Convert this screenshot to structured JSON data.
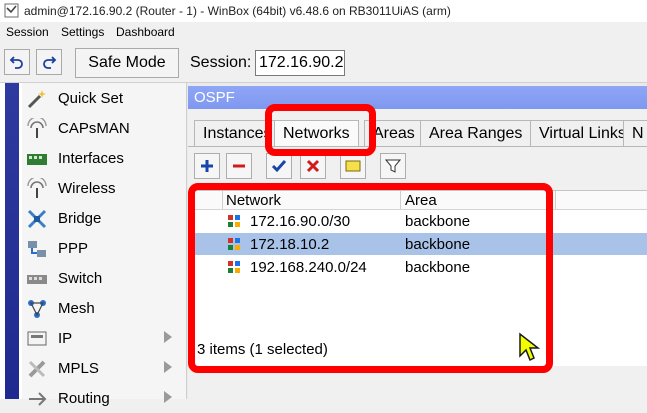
{
  "window": {
    "title": "admin@172.16.90.2 (Router - 1) - WinBox (64bit) v6.48.6 on RB3011UiAS (arm)"
  },
  "menu": [
    "Session",
    "Settings",
    "Dashboard"
  ],
  "toolbar": {
    "safe_mode": "Safe Mode",
    "session_label": "Session:",
    "session_value": "172.16.90.2"
  },
  "sidebar": {
    "items": [
      {
        "label": "Quick Set",
        "icon": "wand-icon"
      },
      {
        "label": "CAPsMAN",
        "icon": "antenna-icon"
      },
      {
        "label": "Interfaces",
        "icon": "interfaces-icon"
      },
      {
        "label": "Wireless",
        "icon": "wireless-icon"
      },
      {
        "label": "Bridge",
        "icon": "bridge-icon"
      },
      {
        "label": "PPP",
        "icon": "ppp-icon"
      },
      {
        "label": "Switch",
        "icon": "switch-icon"
      },
      {
        "label": "Mesh",
        "icon": "mesh-icon"
      },
      {
        "label": "IP",
        "icon": "ip-icon",
        "submenu": true
      },
      {
        "label": "MPLS",
        "icon": "mpls-icon",
        "submenu": true
      },
      {
        "label": "Routing",
        "icon": "routing-icon",
        "submenu": true
      }
    ]
  },
  "ospf": {
    "title": "OSPF",
    "tabs": [
      "Instances",
      "Networks",
      "Areas",
      "Area Ranges",
      "Virtual Links",
      "N"
    ],
    "active_tab": "Networks",
    "columns": [
      "Network",
      "Area"
    ],
    "rows": [
      {
        "network": "172.16.90.0/30",
        "area": "backbone",
        "selected": false
      },
      {
        "network": "172.18.10.2",
        "area": "backbone",
        "selected": true
      },
      {
        "network": "192.168.240.0/24",
        "area": "backbone",
        "selected": false
      }
    ],
    "status": "3 items (1 selected)"
  },
  "colors": {
    "highlight": "#ff0000",
    "selection": "#a9c3e8",
    "window_title": "#8aa2f4",
    "left_stripe": "#2536a0"
  }
}
